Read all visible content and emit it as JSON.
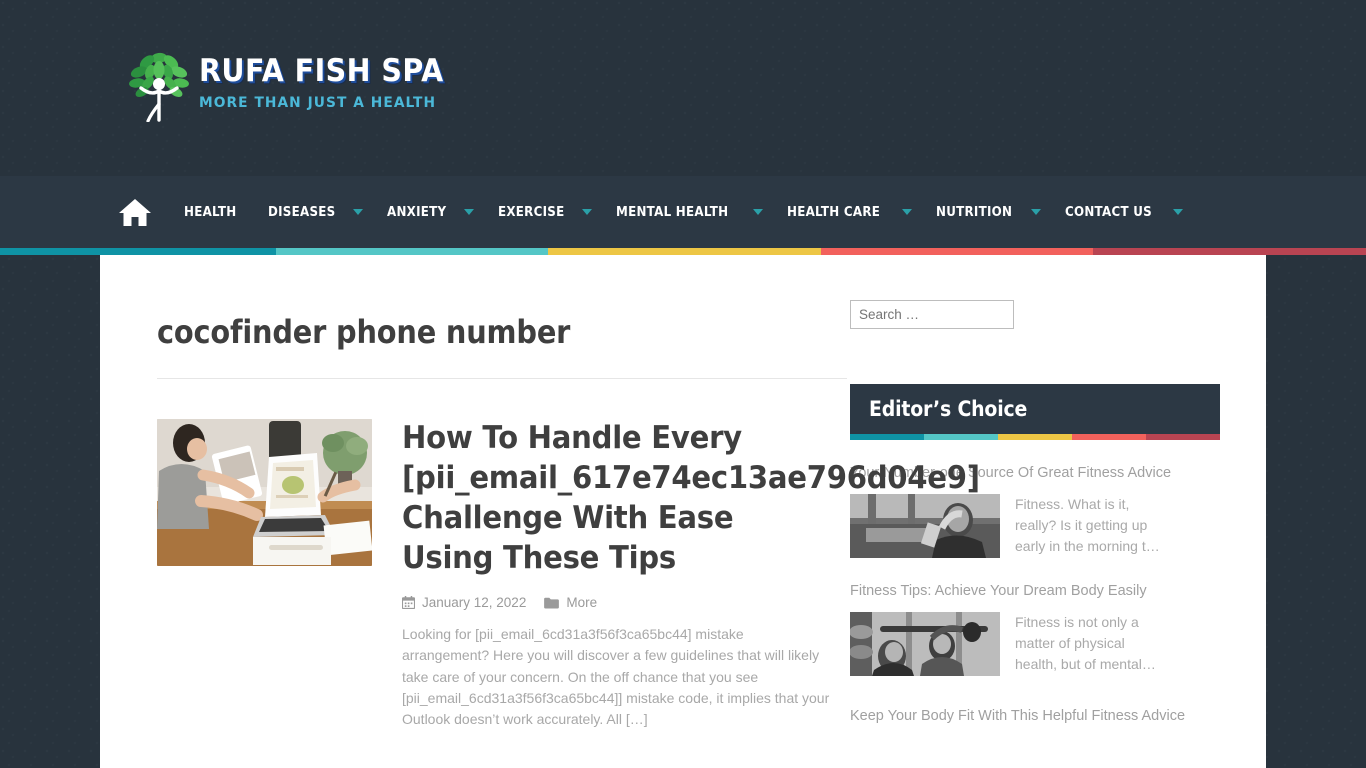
{
  "site": {
    "logo_title": "RUFA FISH SPA",
    "logo_tagline": "MORE THAN JUST A HEALTH",
    "logo_icon": "tree-person-logo"
  },
  "nav": {
    "home_icon": "home-icon",
    "items": [
      {
        "label": "HEALTH",
        "has_dropdown": false
      },
      {
        "label": "DISEASES",
        "has_dropdown": true
      },
      {
        "label": "ANXIETY",
        "has_dropdown": true
      },
      {
        "label": "EXERCISE",
        "has_dropdown": true
      },
      {
        "label": "MENTAL HEALTH",
        "has_dropdown": true
      },
      {
        "label": "HEALTH CARE",
        "has_dropdown": true
      },
      {
        "label": "NUTRITION",
        "has_dropdown": true
      },
      {
        "label": "CONTACT US",
        "has_dropdown": true
      }
    ]
  },
  "stripe": {
    "colors": [
      "#0f93a5",
      "#54c6c6",
      "#edc645",
      "#f2615c",
      "#b94452"
    ],
    "widths": [
      "20.2%",
      "19.9%",
      "20.0%",
      "19.9%",
      "20.0%"
    ]
  },
  "widget_stripe": {
    "colors": [
      "#0f93a5",
      "#54c6c6",
      "#edc645",
      "#f2615c",
      "#b94452"
    ]
  },
  "archive": {
    "title": "cocofinder phone number"
  },
  "post": {
    "thumb_alt": "people-at-desk-with-laptop",
    "title": "How To Handle Every [pii_email_617e74ec13ae796d04e9] Challenge With Ease Using These Tips",
    "date_icon": "calendar-icon",
    "date": "January 12, 2022",
    "category_icon": "folder-icon",
    "category": "More",
    "excerpt": "Looking for [pii_email_6cd31a3f56f3ca65bc44] mistake arrangement? Here you will discover a few guidelines that will likely take care of your concern. On the off chance that you see [pii_email_6cd31a3f56f3ca65bc44]] mistake code, it implies that your Outlook doesn’t work accurately. All […]"
  },
  "sidebar": {
    "search": {
      "placeholder": "Search …",
      "value": ""
    },
    "editors_choice": {
      "title": "Editor’s Choice",
      "posts": [
        {
          "title": "Your Number-one Source Of Great Fitness Advice",
          "excerpt": "Fitness. What is it, really? Is it getting up early in the morning t…",
          "thumb_alt": "man-at-gym-towel"
        },
        {
          "title": "Fitness Tips: Achieve Your Dream Body Easily",
          "excerpt": "Fitness is not only a matter of physical health, but of mental…",
          "thumb_alt": "woman-lifting-barbell"
        },
        {
          "title": "Keep Your Body Fit With This Helpful Fitness Advice",
          "excerpt": "",
          "thumb_alt": ""
        }
      ]
    }
  },
  "theme": {
    "header_bg": "#28333d",
    "nav_bg": "#2c3844",
    "content_bg": "#ffffff",
    "heading_color": "#3f3f3f",
    "muted_text": "#a8a8a8",
    "caret_color": "#2aa0a8",
    "logo_accent": "#4bb8d8"
  }
}
